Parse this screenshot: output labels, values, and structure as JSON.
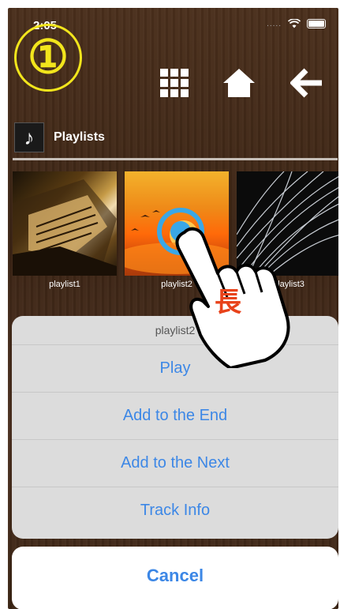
{
  "status": {
    "time": "2:05",
    "dots": "....."
  },
  "step_marker": "①",
  "nav": {
    "icons": [
      "grid-icon",
      "home-icon",
      "back-arrow-icon"
    ]
  },
  "section": {
    "icon": "music-note-icon",
    "title": "Playlists"
  },
  "playlists": [
    {
      "label": "playlist1"
    },
    {
      "label": "playlist2"
    },
    {
      "label": "playlist3"
    }
  ],
  "gesture": {
    "label": "長"
  },
  "action_sheet": {
    "title": "playlist2",
    "buttons": [
      {
        "label": "Play"
      },
      {
        "label": "Add to the End"
      },
      {
        "label": "Add to the Next"
      },
      {
        "label": "Track Info"
      }
    ],
    "cancel": "Cancel"
  },
  "colors": {
    "accent": "#3c87e6",
    "marker": "#f2e51c",
    "tap": "#3aa7e6",
    "gesture_text": "#e8421a"
  }
}
